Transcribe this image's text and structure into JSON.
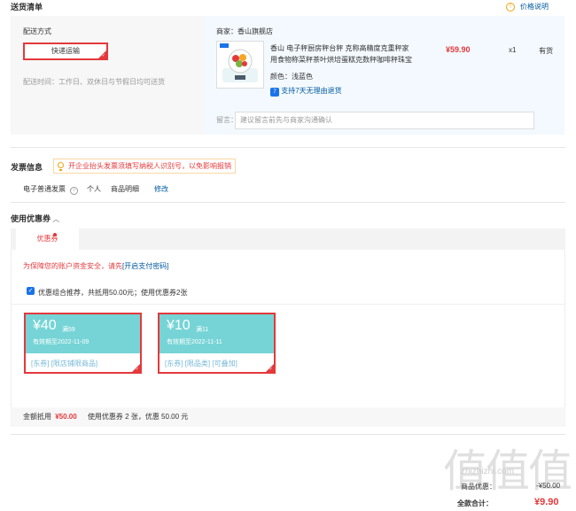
{
  "shipping_list": {
    "title": "送货清单",
    "price_help": "价格说明",
    "delivery_label": "配送方式",
    "delivery_option": "快递运输",
    "delivery_time": "配送时间：工作日、双休日与节假日均可送货",
    "merchant_label": "商家：",
    "merchant_name": "香山旗舰店",
    "product_title_line1": "香山 电子秤厨房秤台秤 克称高精度克重秤家",
    "product_title_line2": "用食物称菜秤茶叶烘培蛋糕克数秤咖啡秤珠宝",
    "price": "¥59.90",
    "quantity": "x1",
    "stock": "有货",
    "color": "颜色：浅蓝色",
    "return_policy": "支持7天无理由退货",
    "remark_label": "留言：",
    "remark_placeholder": "建议留言前先与商家沟通确认"
  },
  "invoice": {
    "title": "发票信息",
    "tip": "开企业抬头发票须填写纳税人识别号，以免影响报销",
    "type": "电子普通发票",
    "holder": "个人",
    "content": "商品明细",
    "edit": "修改"
  },
  "coupons": {
    "title": "使用优惠券",
    "tab": "优惠券",
    "security_notice": "为保障您的账户资金安全，请先",
    "security_link": "[开启支付密码]",
    "combo_checked": true,
    "combo_text": "优惠组合推荐，共抵用50.00元；使用优惠券2张",
    "items": [
      {
        "amount": "¥40",
        "condition": "满59",
        "valid": "有效期至2022-11-09",
        "tags": [
          "[东券]",
          "[限店铺限商品]"
        ]
      },
      {
        "amount": "¥10",
        "condition": "满11",
        "valid": "有效期至2022-11-11",
        "tags": [
          "[东券]",
          "[限品类]",
          "[可叠加]"
        ]
      }
    ],
    "deduct_label": "金额抵用",
    "deduct_amount": "¥50.00",
    "deduct_detail": "使用优惠券 2 张，优惠 50.00 元"
  },
  "totals": {
    "discount_label": "商品优惠：",
    "discount_value": "-¥50.00",
    "total_label": "全款合计：",
    "total_value": "¥9.90"
  },
  "watermark": {
    "logo_text": "值值值",
    "url": "zhizhizhi.com"
  }
}
